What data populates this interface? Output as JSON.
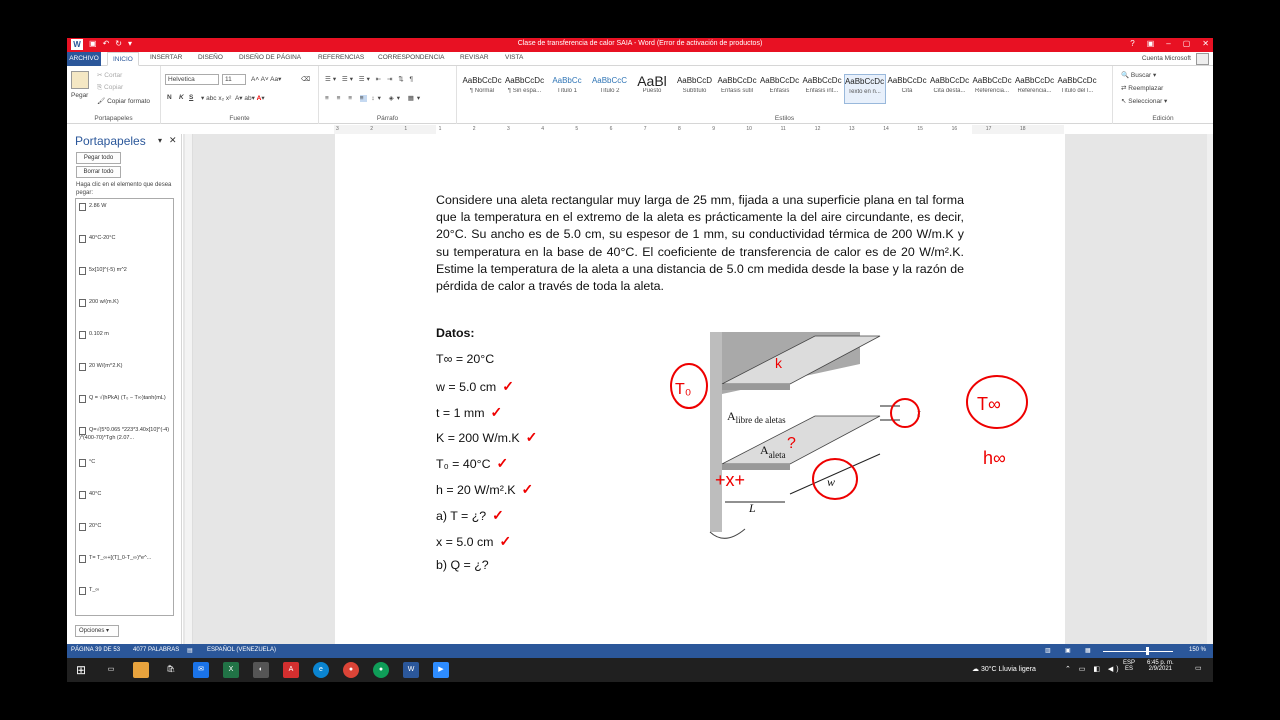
{
  "window": {
    "title": "Clase de transferencia de calor SAIA - Word (Error de activación de productos)"
  },
  "ribbon_tabs": {
    "file": "ARCHIVO",
    "tabs": [
      "INICIO",
      "INSERTAR",
      "DISEÑO",
      "DISEÑO DE PÁGINA",
      "REFERENCIAS",
      "CORRESPONDENCIA",
      "REVISAR",
      "VISTA"
    ],
    "account": "Cuenta Microsoft"
  },
  "ribbon": {
    "clipboard": {
      "paste": "Pegar",
      "cut": "Cortar",
      "copy": "Copiar",
      "format_painter": "Copiar formato",
      "label": "Portapapeles"
    },
    "font": {
      "name": "Helvetica",
      "size": "11",
      "bold": "N",
      "italic": "K",
      "underline": "S",
      "label": "Fuente"
    },
    "paragraph": {
      "label": "Párrafo"
    },
    "styles": {
      "label": "Estilos",
      "items": [
        {
          "preview": "AaBbCcDc",
          "name": "¶ Normal"
        },
        {
          "preview": "AaBbCcDc",
          "name": "¶ Sin espa..."
        },
        {
          "preview": "AaBbCc",
          "name": "Título 1"
        },
        {
          "preview": "AaBbCcC",
          "name": "Título 2"
        },
        {
          "preview": "AaBl",
          "name": "Puesto"
        },
        {
          "preview": "AaBbCcD",
          "name": "Subtítulo"
        },
        {
          "preview": "AaBbCcDc",
          "name": "Énfasis sutil"
        },
        {
          "preview": "AaBbCcDc",
          "name": "Énfasis"
        },
        {
          "preview": "AaBbCcDc",
          "name": "Énfasis int..."
        },
        {
          "preview": "AaBbCcDc",
          "name": "Texto en n..."
        },
        {
          "preview": "AaBbCcDc",
          "name": "Cita"
        },
        {
          "preview": "AaBbCcDc",
          "name": "Cita desta..."
        },
        {
          "preview": "AaBbCcDc",
          "name": "Referencia..."
        },
        {
          "preview": "AaBbCcDc",
          "name": "Referencia..."
        },
        {
          "preview": "AaBbCcDc",
          "name": "Título del l..."
        }
      ]
    },
    "editing": {
      "find": "Buscar",
      "replace": "Reemplazar",
      "select": "Seleccionar",
      "label": "Edición"
    }
  },
  "ruler": {
    "ticks": [
      "3",
      "2",
      "1",
      "1",
      "2",
      "3",
      "4",
      "5",
      "6",
      "7",
      "8",
      "9",
      "10",
      "11",
      "12",
      "13",
      "14",
      "15",
      "16",
      "17",
      "18"
    ]
  },
  "clipboard_pane": {
    "title": "Portapapeles",
    "paste_all": "Pegar todo",
    "clear_all": "Borrar todo",
    "hint": "Haga clic en el elemento que desea pegar:",
    "items": [
      "2.86 W",
      "40°C-20°C",
      "5x[10]^(-5) m^2",
      "200 w/(m.K)",
      "0.102 m",
      "20 W/(m^2.K)",
      "Q = √(hPkA) (T₀ − T∞)tanh(mL)",
      "Q=√(5*0.065 *223*3.40x[10]^(-4) )*(400-70)*Tgh (2.07...",
      "°C",
      "40°C",
      "20°C",
      "T= T_∞+[(T]_0-T_∞)*e^...",
      "T_∞"
    ],
    "options": "Opciones"
  },
  "document": {
    "paragraph": "Considere una aleta rectangular muy larga de 25 mm, fijada a una superficie plana en tal forma que la temperatura en el extremo de la aleta es prácticamente la del aire circundante, es decir, 20°C. Su ancho es de 5.0 cm, su espesor de 1 mm, su conductividad térmica de 200 W/m.K y su temperatura en la base de 40°C. El coeficiente de transferencia de calor es de 20 W/m².K. Estime la temperatura de la aleta a una distancia de 5.0 cm medida desde la base y la razón de pérdida de calor a través de toda la aleta.",
    "data_title": "Datos:",
    "data_lines": [
      "T∞ = 20°C",
      "w = 5.0 cm",
      "t = 1 mm",
      "K = 200 W/m.K",
      "T₀ = 40°C",
      "h = 20 W/m².K",
      "a) T = ¿?",
      "x = 5.0 cm",
      "b) Q = ¿?"
    ],
    "check_mark": "✓",
    "figure": {
      "label_fin_free": "A",
      "label_fin_free_sub": "libre de aletas",
      "label_fin": "A",
      "label_fin_sub": "aleta",
      "label_t": "t",
      "label_w": "w",
      "label_L": "L",
      "hand_T0": "T₀",
      "hand_k": "k",
      "hand_x": "+x+",
      "hand_q": "?",
      "hand_tinf": "T∞",
      "hand_hinf": "h∞"
    }
  },
  "status_bar": {
    "page": "PÁGINA 39 DE 53",
    "words": "4077 PALABRAS",
    "language": "ESPAÑOL (VENEZUELA)",
    "zoom": "150 %"
  },
  "taskbar": {
    "weather": "30°C  Lluvia ligera",
    "lang": "ESP",
    "lang2": "ES",
    "time": "6:45 p. m.",
    "date": "2/9/2021"
  },
  "colors": {
    "word_blue": "#2b579a",
    "title_red": "#e81123",
    "ink_red": "#e00000"
  }
}
